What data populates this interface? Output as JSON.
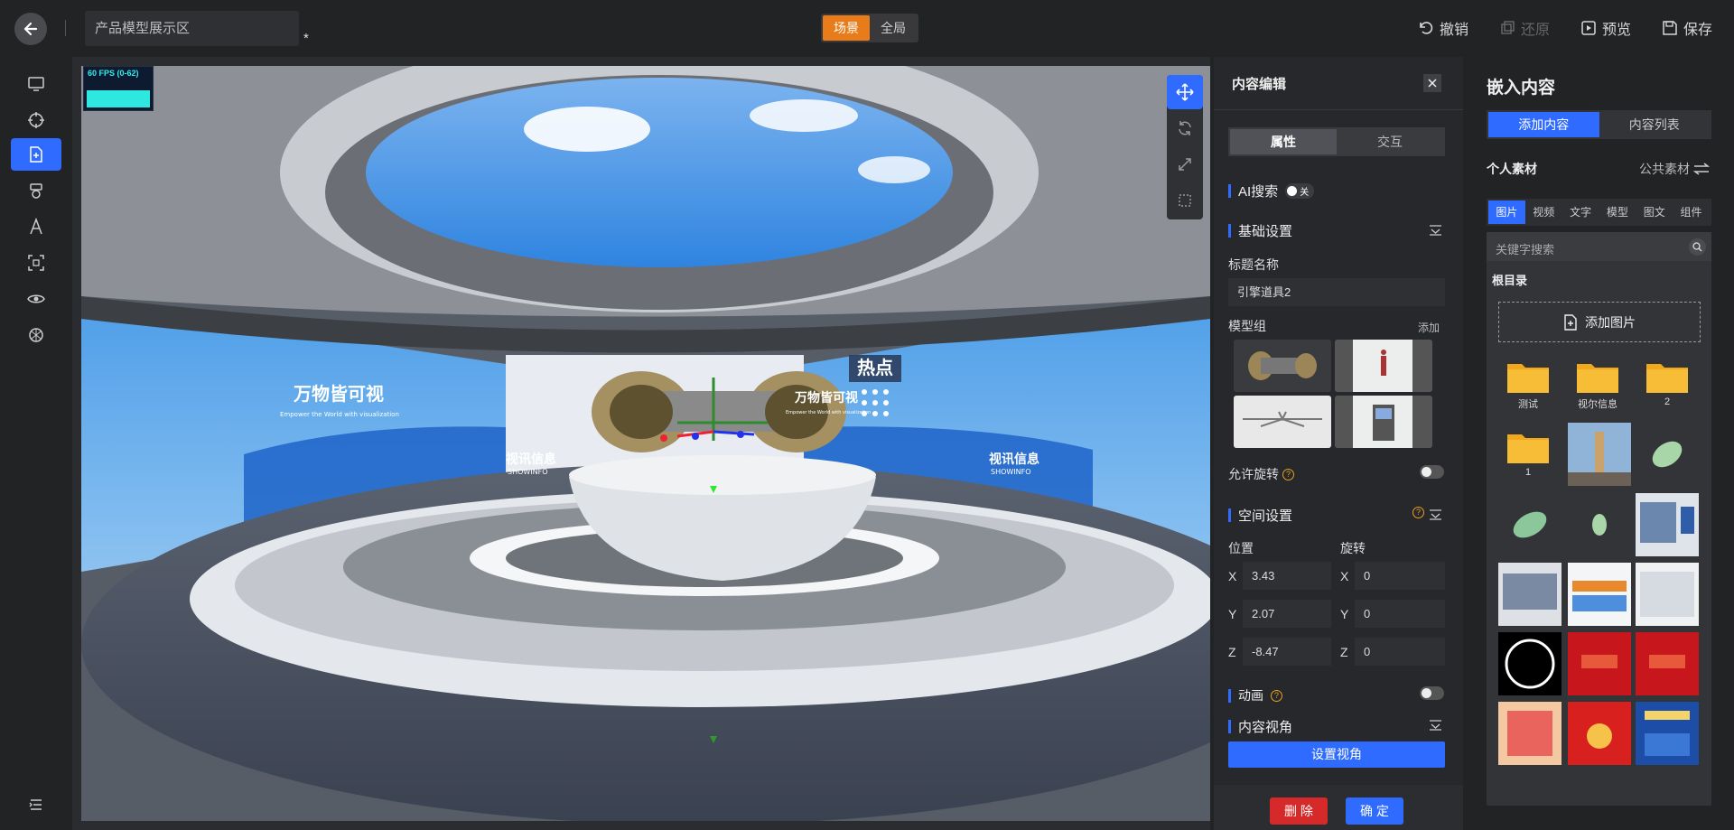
{
  "topbar": {
    "project_name": "产品模型展示区",
    "unsaved_mark": "*",
    "view_toggle": [
      "场景",
      "全局"
    ],
    "actions": {
      "undo": "撤销",
      "redo": "还原",
      "preview": "预览",
      "save": "保存"
    }
  },
  "viewport": {
    "fps": "60 FPS (0-62)",
    "screen_text_left": "万物皆可视",
    "screen_sub_left": "Empower the World with visualization",
    "screen_text_right": "万物皆可视",
    "screen_sub_right": "Empower the World with visualization",
    "brand_left": "视讯信息",
    "brand_left_en": "SHOWINFO",
    "brand_right": "视讯信息",
    "brand_right_en": "SHOWINFO",
    "hotspot_label": "热点"
  },
  "editor": {
    "title": "内容编辑",
    "tabs": [
      "属性",
      "交互"
    ],
    "ai_search": "AI搜索",
    "ai_toggle": "关",
    "basic_settings": "基础设置",
    "title_label": "标题名称",
    "title_value": "引擎道具2",
    "model_group": "模型组",
    "add": "添加",
    "allow_rotate": "允许旋转",
    "space_settings": "空间设置",
    "position": "位置",
    "rotation": "旋转",
    "pos": {
      "x": "3.43",
      "y": "2.07",
      "z": "-8.47"
    },
    "rot": {
      "x": "0",
      "y": "0",
      "z": "0"
    },
    "axis": {
      "x": "X",
      "y": "Y",
      "z": "Z"
    },
    "animation": "动画",
    "content_view": "内容视角",
    "set_view": "设置视角",
    "delete": "删 除",
    "confirm": "确 定"
  },
  "embed": {
    "title": "嵌入内容",
    "tabs": [
      "添加内容",
      "内容列表"
    ],
    "personal": "个人素材",
    "public": "公共素材",
    "categories": [
      "图片",
      "视频",
      "文字",
      "模型",
      "图文",
      "组件"
    ],
    "search_placeholder": "关键字搜索",
    "root": "根目录",
    "add_image": "添加图片",
    "folders": [
      "测试",
      "视尔信息",
      "2",
      "1"
    ]
  },
  "colors": {
    "accent": "#2f6bff",
    "orange": "#e87c1a",
    "danger": "#d62a2a"
  }
}
